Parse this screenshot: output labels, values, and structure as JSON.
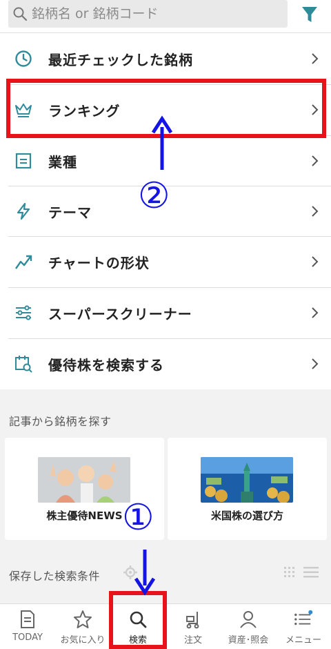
{
  "search": {
    "placeholder": "銘柄名 or 銘柄コード",
    "icon": "search-icon",
    "filter_icon": "filter-icon",
    "accent": "#2e8b9a"
  },
  "menu": {
    "items": [
      {
        "label": "最近チェックした銘柄",
        "icon": "clock-icon"
      },
      {
        "label": "ランキング",
        "icon": "crown-icon"
      },
      {
        "label": "業種",
        "icon": "document-icon"
      },
      {
        "label": "テーマ",
        "icon": "lightning-icon"
      },
      {
        "label": "チャートの形状",
        "icon": "trend-chart-icon"
      },
      {
        "label": "スーパースクリーナー",
        "icon": "sliders-icon"
      },
      {
        "label": "優待株を検索する",
        "icon": "calendar-search-icon"
      }
    ]
  },
  "articles": {
    "title": "記事から銘柄を探す",
    "cards": [
      {
        "label": "株主優待NEWS"
      },
      {
        "label": "米国株の選び方"
      }
    ]
  },
  "saved": {
    "title": "保存した検索条件"
  },
  "tabbar": {
    "tabs": [
      {
        "label": "TODAY",
        "icon": "document-tab-icon",
        "active": false
      },
      {
        "label": "お気に入り",
        "icon": "star-icon",
        "active": false
      },
      {
        "label": "検索",
        "icon": "search-tab-icon",
        "active": true
      },
      {
        "label": "注文",
        "icon": "cart-icon",
        "active": false
      },
      {
        "label": "資産･照会",
        "icon": "person-icon",
        "active": false
      },
      {
        "label": "メニュー",
        "icon": "menu-list-icon",
        "active": false
      }
    ]
  },
  "annotations": {
    "step1": "①",
    "step2": "②",
    "box_color": "#e8121a",
    "arrow_color": "#1414e6"
  }
}
